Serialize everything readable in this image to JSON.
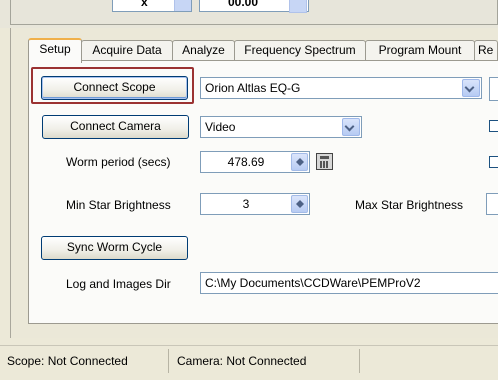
{
  "top_controls": {
    "spin_value": "x",
    "combo_value": "00.00"
  },
  "tabs": [
    {
      "label": "Setup",
      "active": true
    },
    {
      "label": "Acquire Data",
      "active": false
    },
    {
      "label": "Analyze",
      "active": false
    },
    {
      "label": "Frequency Spectrum",
      "active": false
    },
    {
      "label": "Program Mount",
      "active": false
    },
    {
      "label": "Re",
      "active": false
    }
  ],
  "setup": {
    "connect_scope_label": "Connect Scope",
    "scope_model": "Orion Altlas EQ-G",
    "connect_camera_label": "Connect Camera",
    "camera_type": "Video",
    "worm_period_label": "Worm period (secs)",
    "worm_period_value": "478.69",
    "min_star_label": "Min Star Brightness",
    "min_star_value": "3",
    "max_star_label": "Max Star Brightness",
    "sync_worm_label": "Sync Worm Cycle",
    "log_dir_label": "Log and Images Dir",
    "log_dir_value": "C:\\My Documents\\CCDWare\\PEMProV2"
  },
  "status": {
    "scope": "Scope: Not Connected",
    "camera": "Camera: Not Connected"
  },
  "icons": {
    "calculator": "calculator-icon",
    "dropdown": "chevron-down-icon",
    "spin": "spin-arrows-icon"
  },
  "colors": {
    "focus_highlight": "#9b3232",
    "active_tab_accent": "#f0b04a",
    "button_border": "#003c74"
  }
}
